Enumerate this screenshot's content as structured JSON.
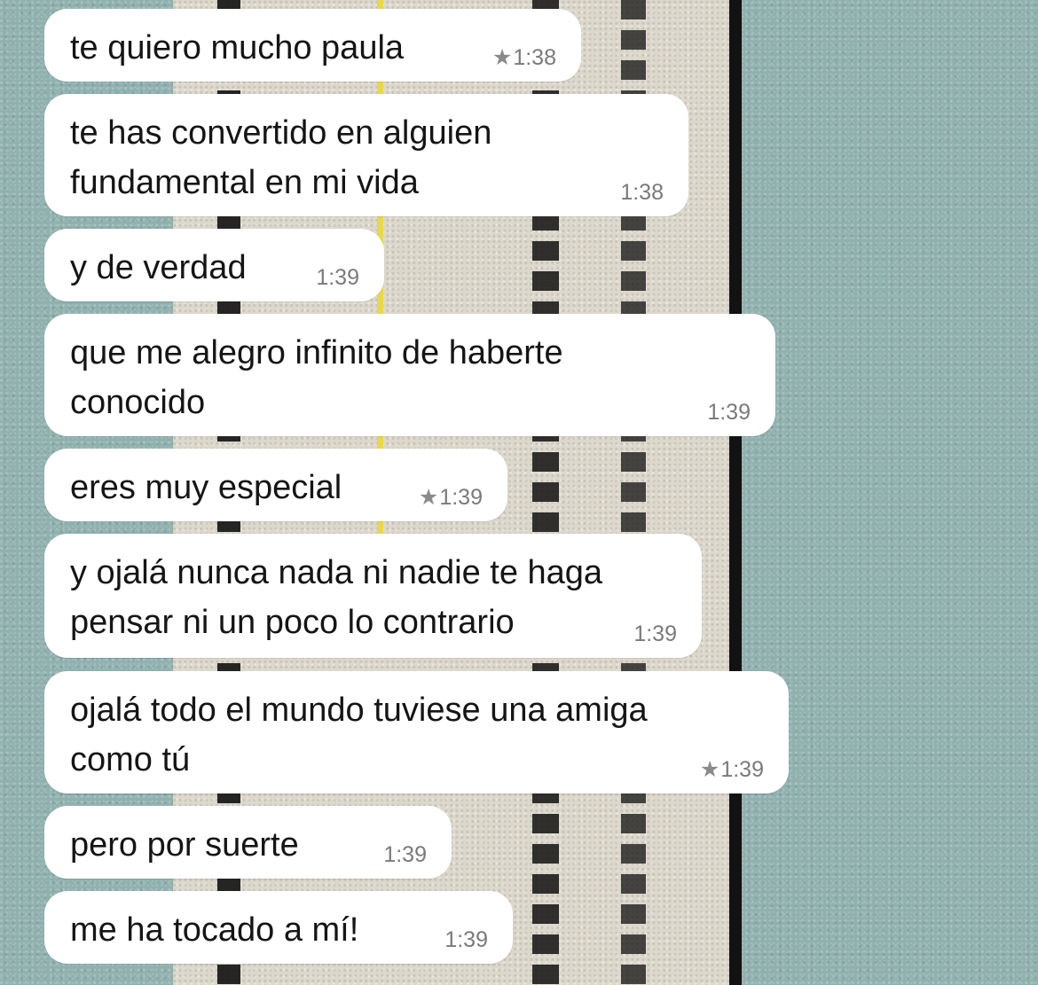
{
  "messages": [
    {
      "text": "te quiero mucho paula",
      "time": "1:38",
      "starred": true
    },
    {
      "text": "te has convertido en alguien\nfundamental en mi vida",
      "time": "1:38",
      "starred": false
    },
    {
      "text": "y de verdad",
      "time": "1:39",
      "starred": false
    },
    {
      "text": "que me alegro infinito de haberte\nconocido",
      "time": "1:39",
      "starred": false
    },
    {
      "text": "eres muy especial",
      "time": "1:39",
      "starred": true
    },
    {
      "text": "y ojalá nunca nada ni nadie te haga\npensar ni un poco lo contrario",
      "time": "1:39",
      "starred": false
    },
    {
      "text": "ojalá todo el mundo tuviese una amiga\ncomo tú",
      "time": "1:39",
      "starred": true
    },
    {
      "text": "pero por suerte",
      "time": "1:39",
      "starred": false
    },
    {
      "text": "me ha tocado a mí!",
      "time": "1:39",
      "starred": false
    }
  ],
  "icons": {
    "star": "star-icon"
  },
  "colors": {
    "bubble": "#ffffff",
    "text": "#151515",
    "timestamp": "#7a7a7a"
  }
}
